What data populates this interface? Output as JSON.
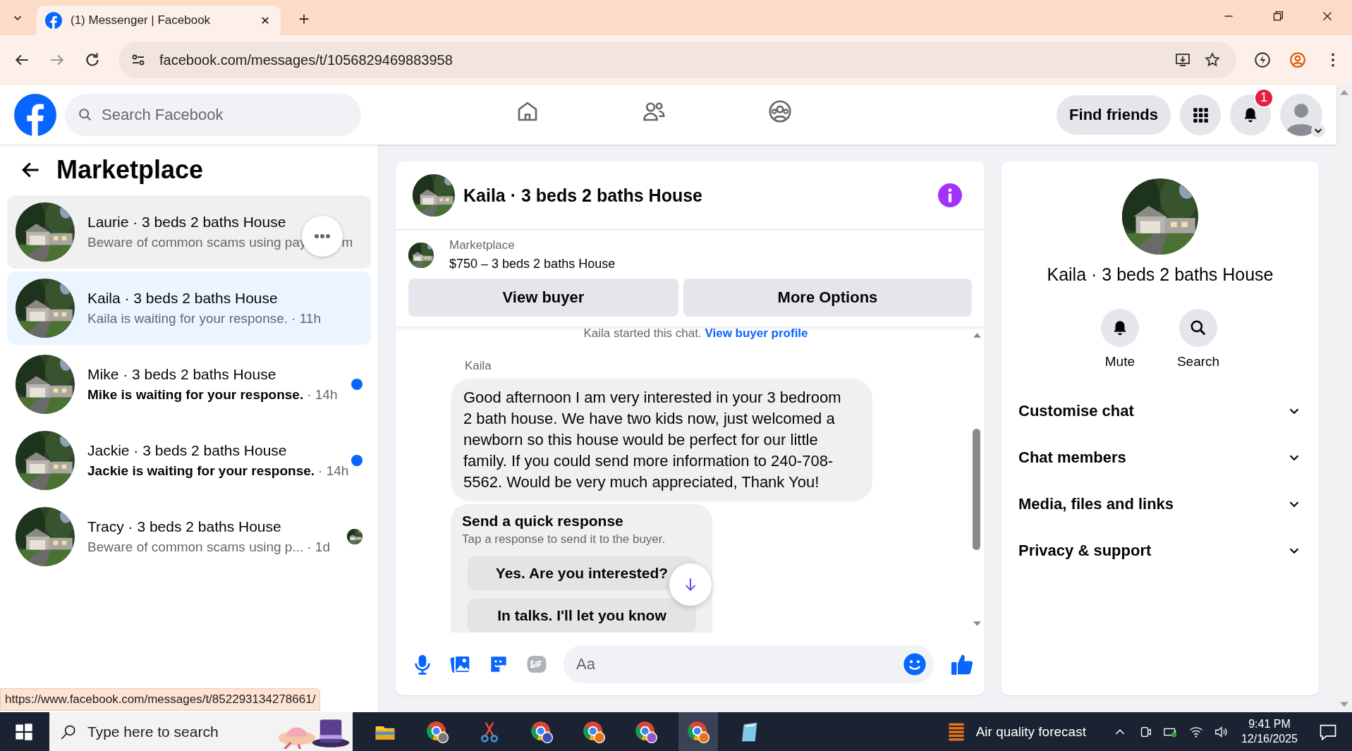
{
  "browser": {
    "tab_title": "(1) Messenger | Facebook",
    "url": "facebook.com/messages/t/1056829469883958",
    "status_url": "https://www.facebook.com/messages/t/852293134278661/"
  },
  "header": {
    "search_placeholder": "Search Facebook",
    "find_friends": "Find friends",
    "notification_count": "1"
  },
  "sidebar": {
    "title": "Marketplace",
    "conversations": [
      {
        "name": "Laurie · 3 beds 2 baths House",
        "preview": "Beware of common scams using pay",
        "time": "m",
        "selected": false,
        "hovered": true,
        "unread": false,
        "seen": false
      },
      {
        "name": "Kaila · 3 beds 2 baths House",
        "preview": "Kaila is waiting for your response.",
        "time": "· 11h",
        "selected": true,
        "hovered": false,
        "unread": false,
        "seen": false
      },
      {
        "name": "Mike · 3 beds 2 baths House",
        "preview": "Mike is waiting for your response.",
        "time": "· 14h",
        "selected": false,
        "hovered": false,
        "unread": true,
        "seen": false
      },
      {
        "name": "Jackie · 3 beds 2 baths House",
        "preview": "Jackie is waiting for your response.",
        "time": "· 14h",
        "selected": false,
        "hovered": false,
        "unread": true,
        "seen": false
      },
      {
        "name": "Tracy · 3 beds 2 baths House",
        "preview": "Beware of common scams using p...",
        "time": "· 1d",
        "selected": false,
        "hovered": false,
        "unread": false,
        "seen": true
      }
    ]
  },
  "chat": {
    "title": "Kaila · 3 beds 2 baths House",
    "listing": {
      "label": "Marketplace",
      "title": "$750 – 3 beds 2 baths House"
    },
    "buttons": [
      "View buyer",
      "More Options"
    ],
    "started_text": "Kaila started this chat.",
    "started_link": "View buyer profile",
    "sender": "Kaila",
    "message": "Good afternoon I am very interested in your 3 bedroom 2 bath house. We have two kids now, just welcomed a newborn so this house would be perfect for our little family. If you could send more information to 240-708-5562. Would be very much appreciated, Thank You!",
    "quick_response": {
      "title": "Send a quick response",
      "subtitle": "Tap a response to send it to the buyer.",
      "options": [
        "Yes. Are you interested?",
        "In talks. I'll let you know"
      ]
    },
    "composer_placeholder": "Aa"
  },
  "details": {
    "name": "Kaila · 3 beds 2 baths House",
    "actions": [
      {
        "label": "Mute",
        "kind": "bell"
      },
      {
        "label": "Search",
        "kind": "search"
      }
    ],
    "sections": [
      "Customise chat",
      "Chat members",
      "Media, files and links",
      "Privacy & support"
    ]
  },
  "taskbar": {
    "search_placeholder": "Type here to search",
    "weather": "Air quality forecast",
    "time": "9:41 PM",
    "date": "12/16/2025"
  }
}
